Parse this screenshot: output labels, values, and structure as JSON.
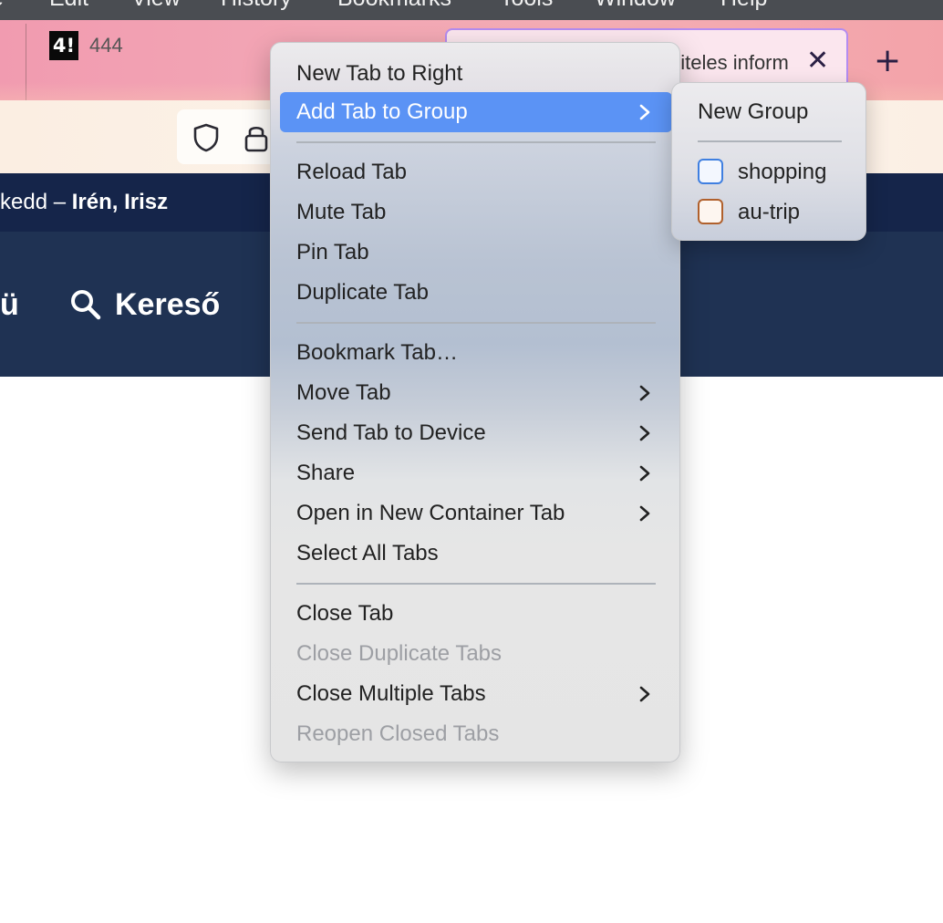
{
  "menubar": {
    "items": [
      "e",
      "Edit",
      "View",
      "History",
      "Bookmarks",
      "Tools",
      "Window",
      "Help"
    ]
  },
  "tabs": {
    "first_tab_favicon": "4!",
    "first_tab_title": "444",
    "active_tab_title": "hiteles inform",
    "close_glyph": "✕",
    "new_tab_glyph": "+"
  },
  "site": {
    "nameday_prefix": "kedd – ",
    "nameday_names": "Irén, Irisz",
    "nav_left_text": "ü",
    "search_label": "Kereső",
    "header_color": "#1f3253"
  },
  "context_menu": {
    "items": [
      {
        "label": "New Tab to Right"
      },
      {
        "label": "Add Tab to Group",
        "submenu": true,
        "highlighted": true
      },
      {
        "label": "Reload Tab"
      },
      {
        "label": "Mute Tab"
      },
      {
        "label": "Pin Tab"
      },
      {
        "label": "Duplicate Tab"
      },
      {
        "label": "Bookmark Tab…"
      },
      {
        "label": "Move Tab",
        "submenu": true
      },
      {
        "label": "Send Tab to Device",
        "submenu": true
      },
      {
        "label": "Share",
        "submenu": true
      },
      {
        "label": "Open in New Container Tab",
        "submenu": true
      },
      {
        "label": "Select All Tabs"
      },
      {
        "label": "Close Tab"
      },
      {
        "label": "Close Duplicate Tabs",
        "disabled": true
      },
      {
        "label": "Close Multiple Tabs",
        "submenu": true
      },
      {
        "label": "Reopen Closed Tabs",
        "disabled": true
      }
    ],
    "highlight_color": "#5b93f5"
  },
  "group_submenu": {
    "new_group_label": "New Group",
    "groups": [
      {
        "label": "shopping",
        "color": "#3f7fe0",
        "fill": "#f3f7fe"
      },
      {
        "label": "au-trip",
        "color": "#b0602c",
        "fill": "#fdf6f0"
      }
    ]
  }
}
